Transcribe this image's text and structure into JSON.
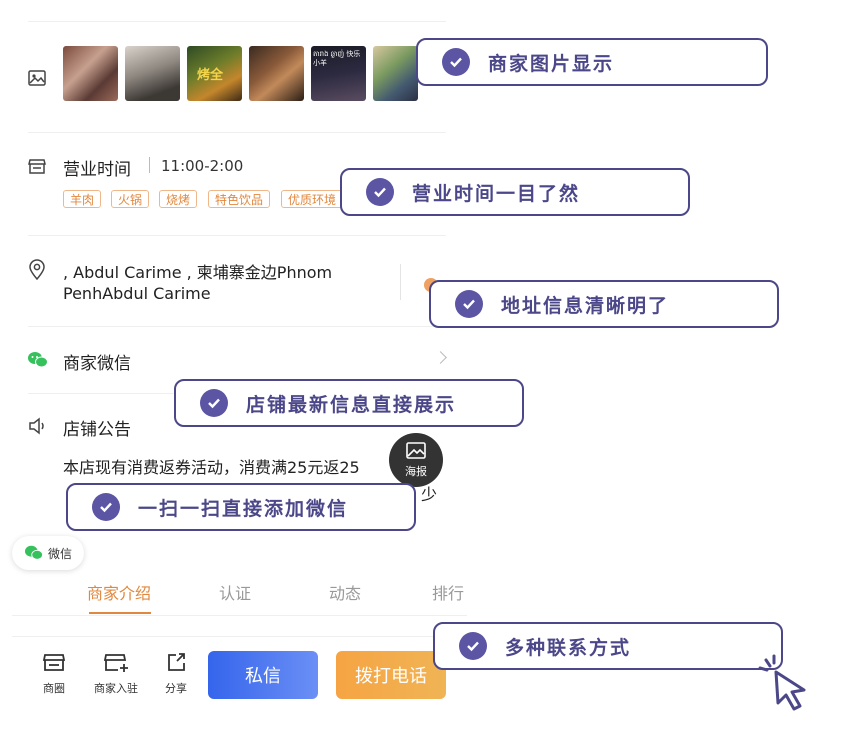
{
  "images_row": {
    "thumbnails": [
      "photo-1",
      "photo-2",
      "photo-3",
      "photo-4",
      "photo-5",
      "photo-6"
    ],
    "thumb_texts": [
      "烤全",
      "តារាង ឆ្ងាញ់ 快乐小羊"
    ]
  },
  "hours": {
    "label": "营业时间",
    "value": "11:00-2:00",
    "tags": [
      "羊肉",
      "火锅",
      "烧烤",
      "特色饮品",
      "优质环境"
    ]
  },
  "address": {
    "line1": ", Abdul Carime , 柬埔寨金边Phnom",
    "line2": "PenhAbdul Carime"
  },
  "wechat": {
    "label": "商家微信"
  },
  "notice": {
    "label": "店铺公告",
    "text": "本店现有消费返券活动，消费满25元返25",
    "text_cut_end": "少"
  },
  "poster": {
    "label": "海报"
  },
  "wechat_float": {
    "label": "微信"
  },
  "tabs": [
    {
      "label": "商家介绍",
      "active": true
    },
    {
      "label": "认证",
      "active": false
    },
    {
      "label": "动态",
      "active": false
    },
    {
      "label": "排行",
      "active": false
    }
  ],
  "bottom_bar": {
    "items": [
      {
        "label": "商圈",
        "icon": "store-icon"
      },
      {
        "label": "商家入驻",
        "icon": "store-add-icon"
      },
      {
        "label": "分享",
        "icon": "share-icon"
      }
    ],
    "message_button": "私信",
    "call_button": "拨打电话"
  },
  "callouts": [
    "商家图片显示",
    "营业时间一目了然",
    "地址信息清晰明了",
    "店铺最新信息直接展示",
    "一扫一扫直接添加微信",
    "多种联系方式"
  ],
  "colors": {
    "accent_orange": "#e0883e",
    "callout_purple": "#4b4788",
    "check_purple": "#5b55a3",
    "message_blue": "#3d74ee",
    "call_orange": "#f6a443",
    "wechat_green": "#35c15c"
  }
}
